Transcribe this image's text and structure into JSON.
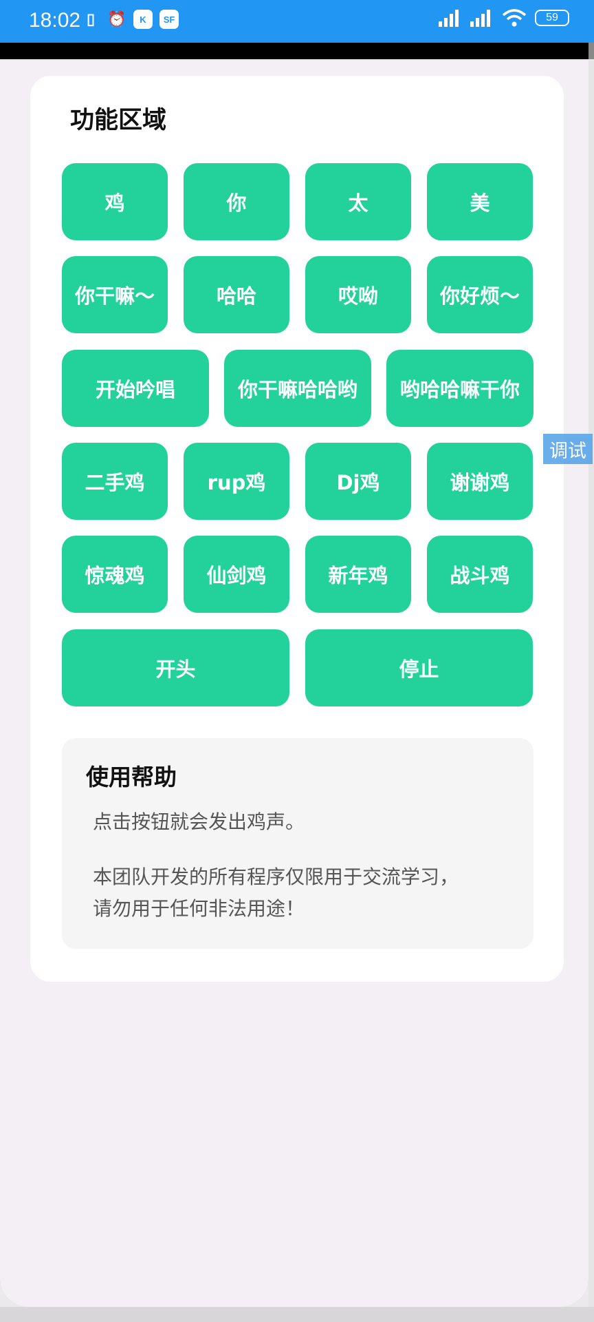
{
  "status_bar": {
    "time": "18:02",
    "left_icons": [
      "phone-icon",
      "alarm-icon",
      "k-app-icon",
      "sf-app-icon"
    ],
    "k_label": "K",
    "sf_label": "SF",
    "battery": "59"
  },
  "function_area": {
    "title": "功能区域",
    "rows": [
      [
        "鸡",
        "你",
        "太",
        "美"
      ],
      [
        "你干嘛～",
        "哈哈",
        "哎呦",
        "你好烦～"
      ],
      [
        "开始吟唱",
        "你干嘛哈哈哟",
        "哟哈哈嘛干你"
      ],
      [
        "二手鸡",
        "rup鸡",
        "Dj鸡",
        "谢谢鸡"
      ],
      [
        "惊魂鸡",
        "仙剑鸡",
        "新年鸡",
        "战斗鸡"
      ],
      [
        "开头",
        "停止"
      ]
    ]
  },
  "help": {
    "title": "使用帮助",
    "line1": "点击按钮就会发出鸡声。",
    "line2": "本团队开发的所有程序仅限用于交流学习，",
    "line3": "请勿用于任何非法用途！"
  },
  "debug_label": "调试",
  "colors": {
    "status_bar": "#2196f3",
    "button": "#23d19a",
    "debug": "#5aa6e8"
  }
}
